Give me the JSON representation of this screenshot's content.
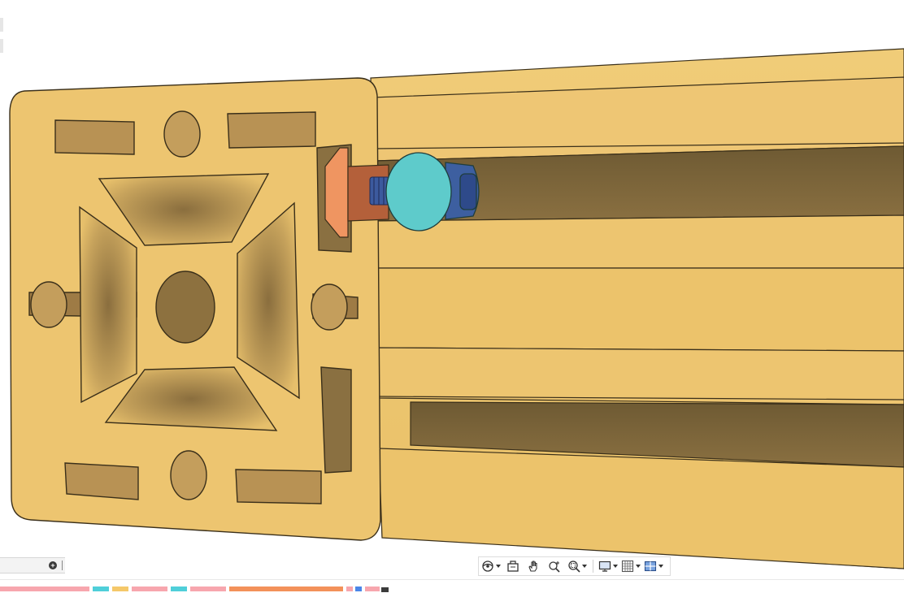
{
  "app": {
    "accent": "#4a86e8"
  },
  "viewport": {
    "model_colors": {
      "extrusion_face": "#ecc36b",
      "extrusion_shadow": "#7a6238",
      "t_nut": "#ef9561",
      "bolt_head": "#5ecbcb",
      "screw": "#3c5a9e"
    }
  },
  "navigation_toolbar": {
    "items": [
      {
        "name": "orbit",
        "icon": "orbit-icon",
        "has_menu": true
      },
      {
        "name": "look-at",
        "icon": "look-at-icon",
        "has_menu": false
      },
      {
        "name": "pan",
        "icon": "pan-hand-icon",
        "has_menu": false
      },
      {
        "name": "zoom",
        "icon": "zoom-icon",
        "has_menu": false
      },
      {
        "name": "fit",
        "icon": "zoom-window-icon",
        "has_menu": true
      },
      {
        "name": "display-settings",
        "icon": "display-icon",
        "has_menu": true
      },
      {
        "name": "grid-snaps",
        "icon": "grid-icon",
        "has_menu": true
      },
      {
        "name": "viewports",
        "icon": "viewports-icon",
        "has_menu": true
      }
    ]
  },
  "timeline": {
    "features": [
      {
        "type": "sketch",
        "color": "#f7a6ae"
      },
      {
        "type": "extrude",
        "color": "#4fcfd9"
      },
      {
        "type": "component",
        "color": "#f5c86a"
      },
      {
        "type": "sketch",
        "color": "#f7a6ae"
      },
      {
        "type": "extrude",
        "color": "#4fcfd9"
      },
      {
        "type": "sketch",
        "color": "#f7a6ae"
      },
      {
        "type": "joint",
        "color": "#f3915a"
      },
      {
        "type": "sketch",
        "color": "#f7a6ae"
      },
      {
        "type": "body",
        "color": "#4a86e8"
      },
      {
        "type": "sketch",
        "color": "#f7a6ae"
      }
    ]
  }
}
